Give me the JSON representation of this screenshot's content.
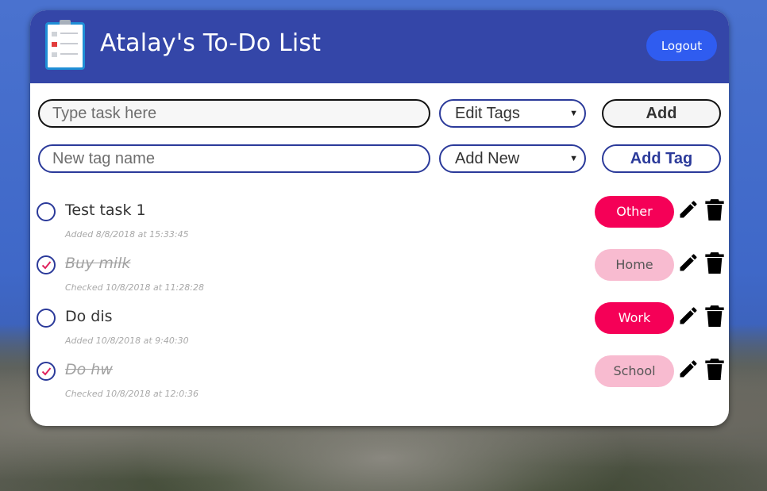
{
  "header": {
    "title": "Atalay's To-Do List",
    "logout_label": "Logout"
  },
  "form": {
    "task_placeholder": "Type task here",
    "tag_select_value": "Edit Tags",
    "add_label": "Add",
    "new_tag_placeholder": "New tag name",
    "new_tag_select_value": "Add New",
    "add_tag_label": "Add Tag"
  },
  "tasks": [
    {
      "name": "Test task 1",
      "checked": false,
      "meta": "Added 8/8/2018 at 15:33:45",
      "tag": "Other",
      "tag_active": true
    },
    {
      "name": "Buy milk",
      "checked": true,
      "meta": "Checked 10/8/2018 at 11:28:28",
      "tag": "Home",
      "tag_active": false
    },
    {
      "name": "Do dis",
      "checked": false,
      "meta": "Added 10/8/2018 at 9:40:30",
      "tag": "Work",
      "tag_active": true
    },
    {
      "name": "Do hw",
      "checked": true,
      "meta": "Checked 10/8/2018 at 12:0:36",
      "tag": "School",
      "tag_active": false
    }
  ],
  "colors": {
    "header_bg": "#3446a8",
    "logout_bg": "#2f5cf0",
    "tag_active": "#f50057",
    "tag_faded": "#f8bbd0",
    "accent_border": "#2b3a9a"
  },
  "icons": [
    "clipboard-logo-icon",
    "pencil-icon",
    "trash-icon",
    "checkmark-icon",
    "dropdown-caret-icon"
  ]
}
